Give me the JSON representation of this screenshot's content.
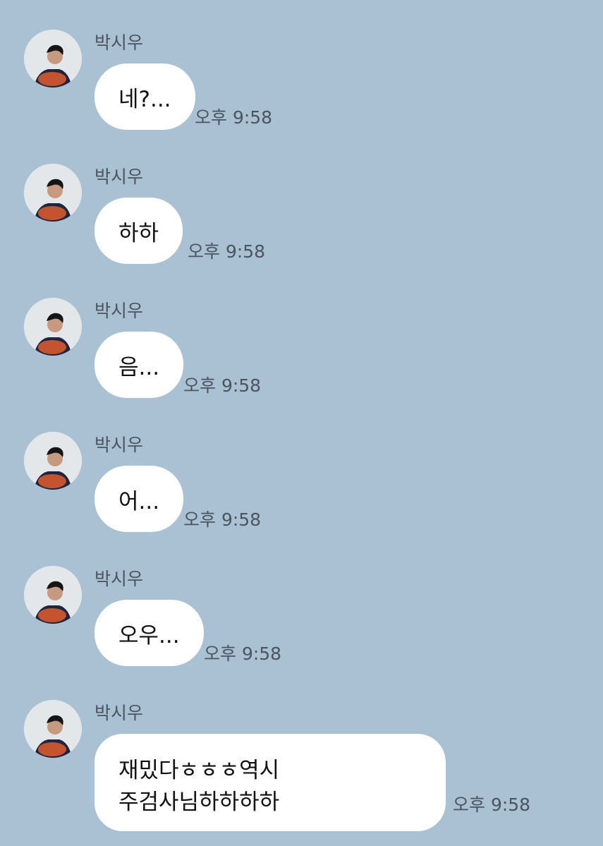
{
  "messages": [
    {
      "sender": "박시우",
      "text": "네?...",
      "time": "오후 9:58"
    },
    {
      "sender": "박시우",
      "text": "하하",
      "time": "오후 9:58"
    },
    {
      "sender": "박시우",
      "text": "음...",
      "time": "오후 9:58"
    },
    {
      "sender": "박시우",
      "text": "어...",
      "time": "오후 9:58"
    },
    {
      "sender": "박시우",
      "text": "오우...",
      "time": "오후 9:58"
    },
    {
      "sender": "박시우",
      "lines": [
        "재밌다ㅎㅎㅎ역시",
        "주검사님하하하하"
      ],
      "time": "오후 9:58"
    }
  ],
  "colors": {
    "background": "#aac0d3",
    "bubble": "#ffffff",
    "meta_text": "#4a5560"
  }
}
